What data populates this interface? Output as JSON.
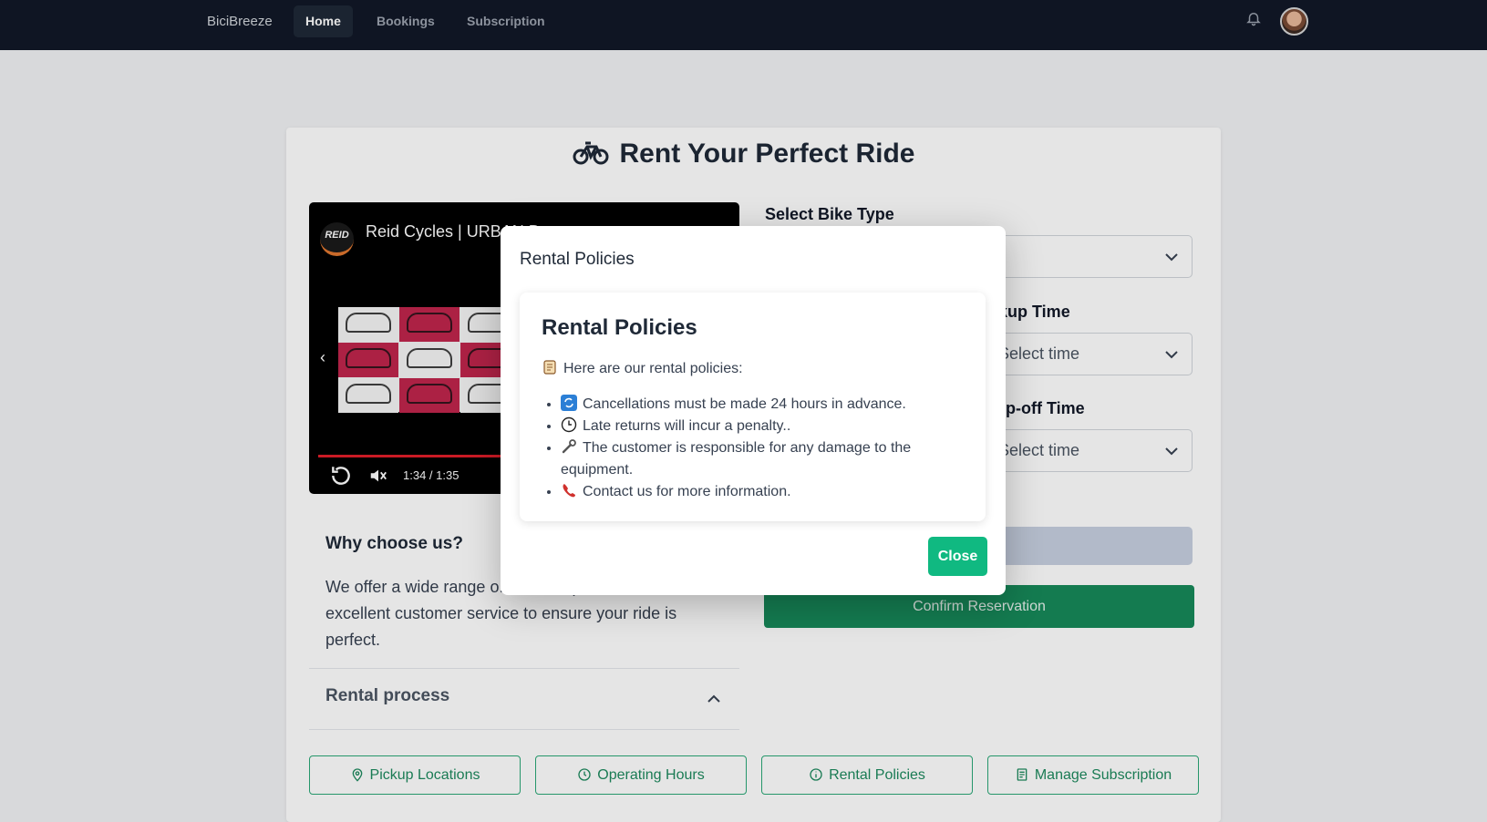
{
  "nav": {
    "brand": "BiciBreeze",
    "links": [
      {
        "label": "Home",
        "active": true
      },
      {
        "label": "Bookings",
        "active": false
      },
      {
        "label": "Subscription",
        "active": false
      }
    ]
  },
  "page": {
    "title": "Rent Your Perfect Ride"
  },
  "video": {
    "channel_logo": "REID",
    "title": "Reid Cycles | URBAN B...",
    "time": "1:34 / 1:35"
  },
  "why": {
    "title": "Why choose us?",
    "text": "We offer a wide range o... rental options, and excellent customer service to ensure your ride is perfect."
  },
  "accordion": {
    "title": "Rental process"
  },
  "form": {
    "bike_type_label": "Select Bike Type",
    "pickup_label": "...ckup Time",
    "pickup_placeholder": "Select time",
    "dropoff_label": "...rop-off Time",
    "dropoff_placeholder": "Select time",
    "confirm_label": "Confirm Reservation"
  },
  "bottom_buttons": [
    {
      "label": "Pickup Locations",
      "icon": "map-pin-icon"
    },
    {
      "label": "Operating Hours",
      "icon": "clock-icon"
    },
    {
      "label": "Rental Policies",
      "icon": "info-icon"
    },
    {
      "label": "Manage Subscription",
      "icon": "document-icon"
    }
  ],
  "modal": {
    "header": "Rental Policies",
    "card_title": "Rental Policies",
    "intro": "Here are our rental policies:",
    "policies": [
      "Cancellations must be made 24 hours in advance.",
      "Late returns will incur a penalty..",
      "The customer is responsible for any damage to the equipment.",
      "Contact us for more information."
    ],
    "close_label": "Close"
  },
  "colors": {
    "nav_bg": "#111827",
    "primary_green": "#178a5a",
    "close_green": "#10b981",
    "outline_green": "#2aa877"
  }
}
